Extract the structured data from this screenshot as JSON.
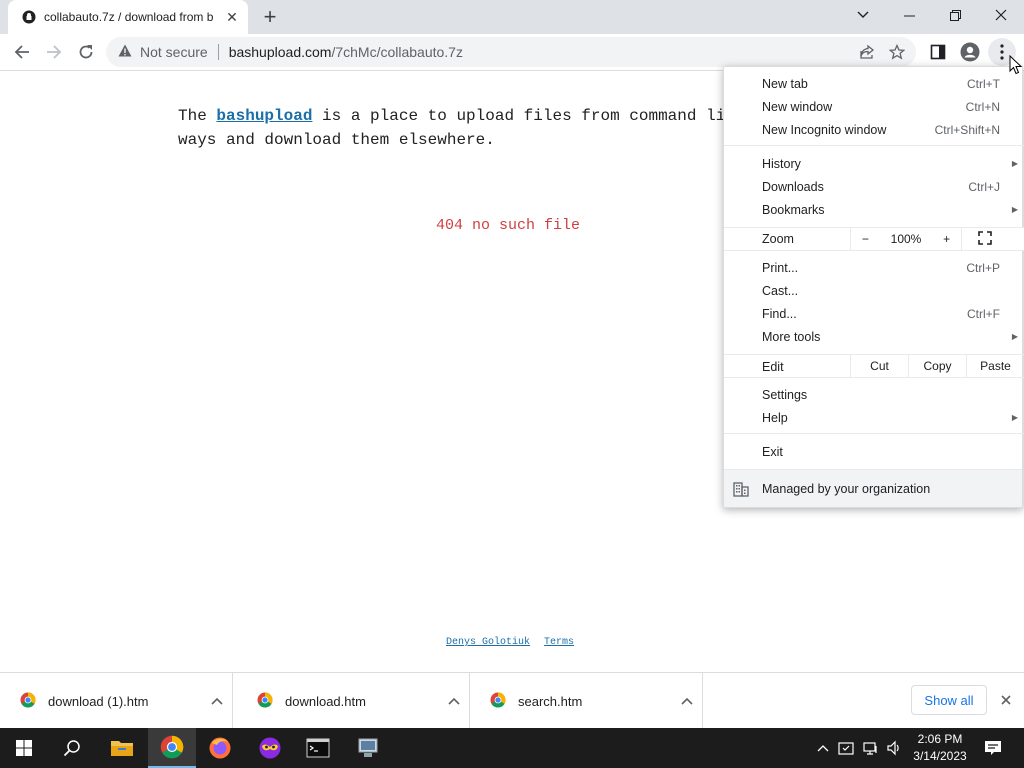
{
  "tab": {
    "title": "collabauto.7z / download from b",
    "close_symbol": "✕",
    "new_tab_symbol": "+"
  },
  "toolbar": {
    "security_label": "Not secure",
    "url_host": "bashupload.com",
    "url_path": "/7chMc/collabauto.7z"
  },
  "page": {
    "intro_before": "The ",
    "intro_link": "bashupload",
    "intro_after": " is a place to upload files from command li",
    "intro_line2": "ways and download them elsewhere.",
    "error": "404 no such file",
    "footer_links": [
      "Denys Golotiuk",
      "Terms"
    ]
  },
  "menu": {
    "items": [
      {
        "label": "New tab",
        "shortcut": "Ctrl+T"
      },
      {
        "label": "New window",
        "shortcut": "Ctrl+N"
      },
      {
        "label": "New Incognito window",
        "shortcut": "Ctrl+Shift+N"
      },
      {
        "label": "History",
        "shortcut": ""
      },
      {
        "label": "Downloads",
        "shortcut": "Ctrl+J"
      },
      {
        "label": "Bookmarks",
        "shortcut": ""
      },
      {
        "label": "Print...",
        "shortcut": "Ctrl+P"
      },
      {
        "label": "Cast...",
        "shortcut": ""
      },
      {
        "label": "Find...",
        "shortcut": "Ctrl+F"
      },
      {
        "label": "More tools",
        "shortcut": ""
      },
      {
        "label": "Settings",
        "shortcut": ""
      },
      {
        "label": "Help",
        "shortcut": ""
      },
      {
        "label": "Exit",
        "shortcut": ""
      }
    ],
    "zoom": {
      "label": "Zoom",
      "minus": "−",
      "value": "100%",
      "plus": "+"
    },
    "edit": {
      "label": "Edit",
      "cut": "Cut",
      "copy": "Copy",
      "paste": "Paste"
    },
    "managed": "Managed by your organization"
  },
  "downloads": {
    "items": [
      "download (1).htm",
      "download.htm",
      "search.htm"
    ],
    "show_all": "Show all"
  },
  "taskbar": {
    "time": "2:06 PM",
    "date": "3/14/2023",
    "apps": [
      "start-icon",
      "search-icon",
      "file-explorer-icon",
      "chrome-icon",
      "firefox-icon",
      "mask-app-icon",
      "terminal-icon",
      "network-app-icon"
    ]
  },
  "colors": {
    "link": "#1a6fa8",
    "error": "#d04040",
    "accent": "#1a73e8",
    "taskbar": "#1c1c1c"
  }
}
